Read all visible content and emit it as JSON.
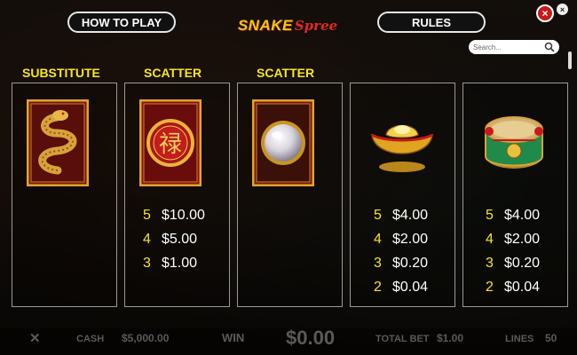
{
  "header": {
    "how_to_play": "HOW TO PLAY",
    "rules": "RULES",
    "logo_line1": "SNAKE",
    "logo_line2": "Spree",
    "close_icon": "×",
    "minimize_icon": "×"
  },
  "search": {
    "placeholder": "Search..."
  },
  "headings": {
    "substitute": "SUBSTITUTE",
    "scatter1": "SCATTER",
    "scatter2": "SCATTER"
  },
  "paytables": {
    "fortune": [
      {
        "count": "5",
        "amount": "$10.00"
      },
      {
        "count": "4",
        "amount": "$5.00"
      },
      {
        "count": "3",
        "amount": "$1.00"
      }
    ],
    "ingot": [
      {
        "count": "5",
        "amount": "$4.00"
      },
      {
        "count": "4",
        "amount": "$2.00"
      },
      {
        "count": "3",
        "amount": "$0.20"
      },
      {
        "count": "2",
        "amount": "$0.04"
      }
    ],
    "drum": [
      {
        "count": "5",
        "amount": "$4.00"
      },
      {
        "count": "4",
        "amount": "$2.00"
      },
      {
        "count": "3",
        "amount": "$0.20"
      },
      {
        "count": "2",
        "amount": "$0.04"
      }
    ]
  },
  "icons": {
    "substitute": "snake-wild-symbol",
    "scatter1": "fortune-character-symbol",
    "scatter2": "pearl-symbol",
    "symbol4": "gold-ingot-symbol",
    "symbol5": "drum-symbol"
  },
  "fortune_char": "禄",
  "bottom_bar": {
    "cash_label": "CASH",
    "cash_value": "$5,000.00",
    "win_label": "WIN",
    "win_value": "$0.00",
    "total_bet_label": "TOTAL BET",
    "total_bet_value": "$1.00",
    "lines_label": "LINES",
    "lines_value": "50"
  },
  "colors": {
    "accent_yellow": "#f5e71a",
    "close_red": "#c81818",
    "panel_border": "#9a9a9a"
  }
}
